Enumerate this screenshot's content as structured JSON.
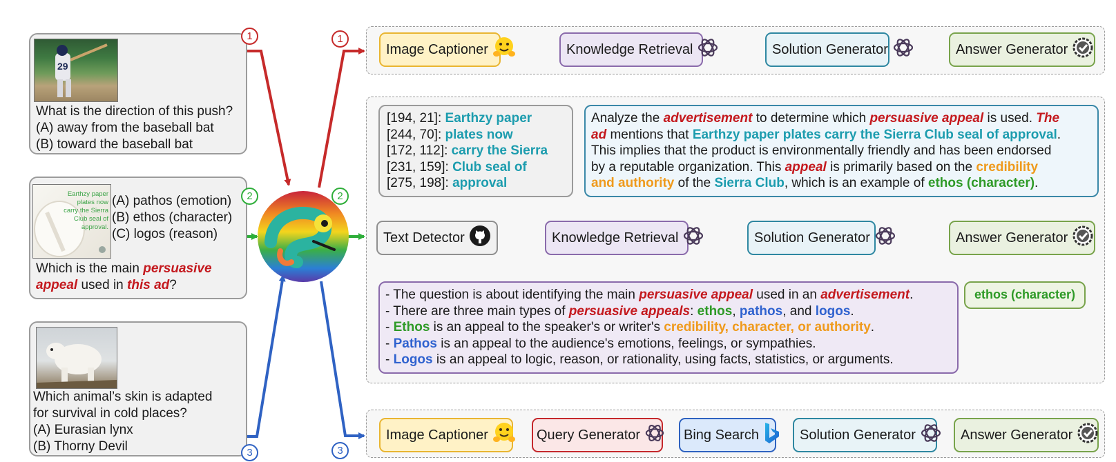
{
  "badges": {
    "one": "1",
    "two": "2",
    "three": "3"
  },
  "questions": {
    "q1": {
      "question": "What is the direction of this push?",
      "optA": "(A) away from the baseball bat",
      "optB": "(B) toward the baseball bat"
    },
    "q2": {
      "image_text": [
        "Earthzy paper",
        "plates now",
        "carry the Sierra",
        "Club seal of",
        "approval."
      ],
      "optA": "(A) pathos (emotion)",
      "optB": "(B) ethos (character)",
      "optC": "(C) logos (reason)",
      "question_parts": [
        "Which is the main ",
        "persuasive",
        "appeal",
        " used in ",
        "this ad",
        "?"
      ]
    },
    "q3": {
      "line1": "Which animal’s skin is adapted",
      "line2": "for survival in cold places?",
      "optA": "(A) Eurasian lynx",
      "optB": "(B) Thorny Devil"
    }
  },
  "pipeline1": {
    "image_captioner": "Image Captioner",
    "knowledge_retrieval": "Knowledge Retrieval",
    "solution_generator": "Solution Generator",
    "answer_generator": "Answer Generator"
  },
  "pipeline2": {
    "text_detector": "Text Detector",
    "knowledge_retrieval": "Knowledge Retrieval",
    "solution_generator": "Solution Generator",
    "answer_generator": "Answer Generator",
    "ocr_output": [
      {
        "coord": "[194, 21]: ",
        "text": "Earthzy paper"
      },
      {
        "coord": "[244, 70]: ",
        "text": "plates now"
      },
      {
        "coord": "[172, 112]: ",
        "text": "carry the Sierra"
      },
      {
        "coord": "[231, 159]: ",
        "text": "Club seal of"
      },
      {
        "coord": "[275, 198]: ",
        "text": "approval"
      }
    ],
    "solution": {
      "l1_a": "Analyze the ",
      "l1_b": "advertisement",
      "l1_c": " to determine which ",
      "l1_d": "persuasive appeal",
      "l1_e": " is used. ",
      "l1_f": "The",
      "l2_a": "ad",
      "l2_b": " mentions that ",
      "l2_c": "Earthzy paper plates carry the Sierra Club seal of approval",
      "l2_d": ".",
      "l3": "This implies that the product is environmentally friendly and has been endorsed",
      "l4_a": "by a reputable organization. This ",
      "l4_b": "appeal",
      "l4_c": " is primarily based on the ",
      "l4_d": "credibility",
      "l5_a": "and authority",
      "l5_b": " of the ",
      "l5_c": "Sierra Club",
      "l5_d": ", which is an example of ",
      "l5_e": "ethos (character)",
      "l5_f": "."
    },
    "knowledge": {
      "l1_a": "- The question is about identifying the main ",
      "l1_b": "persuasive appeal",
      "l1_c": " used in an ",
      "l1_d": "advertisement",
      "l1_e": ".",
      "l2_a": "- There are three main types of ",
      "l2_b": "persuasive appeals",
      "l2_c": ": ",
      "l2_d": "ethos",
      "l2_e": ", ",
      "l2_f": "pathos",
      "l2_g": ", and ",
      "l2_h": "logos",
      "l2_i": ".",
      "l3_a": "- ",
      "l3_b": "Ethos",
      "l3_c": " is an appeal to the speaker's or writer's ",
      "l3_d": "credibility, character, or authority",
      "l3_e": ".",
      "l4_a": "- ",
      "l4_b": "Pathos",
      "l4_c": " is an appeal to the audience's emotions, feelings, or sympathies.",
      "l5_a": "- ",
      "l5_b": "Logos",
      "l5_c": " is an appeal to logic, reason, or rationality, using facts, statistics, or arguments."
    },
    "final_answer": "ethos (character)"
  },
  "pipeline3": {
    "image_captioner": "Image Captioner",
    "query_generator": "Query Generator",
    "bing_search": "Bing Search",
    "solution_generator": "Solution Generator",
    "answer_generator": "Answer Generator"
  },
  "colors": {
    "path1": "#c62a2a",
    "path2": "#2fae3a",
    "path3": "#2f62c3",
    "dark_arrow": "#1a1a1a",
    "gray_arrow": "#9a9a9a",
    "teal_arrow": "#2e87a1",
    "purple_arrow": "#8a6aab",
    "green_arrow": "#78a34b"
  }
}
